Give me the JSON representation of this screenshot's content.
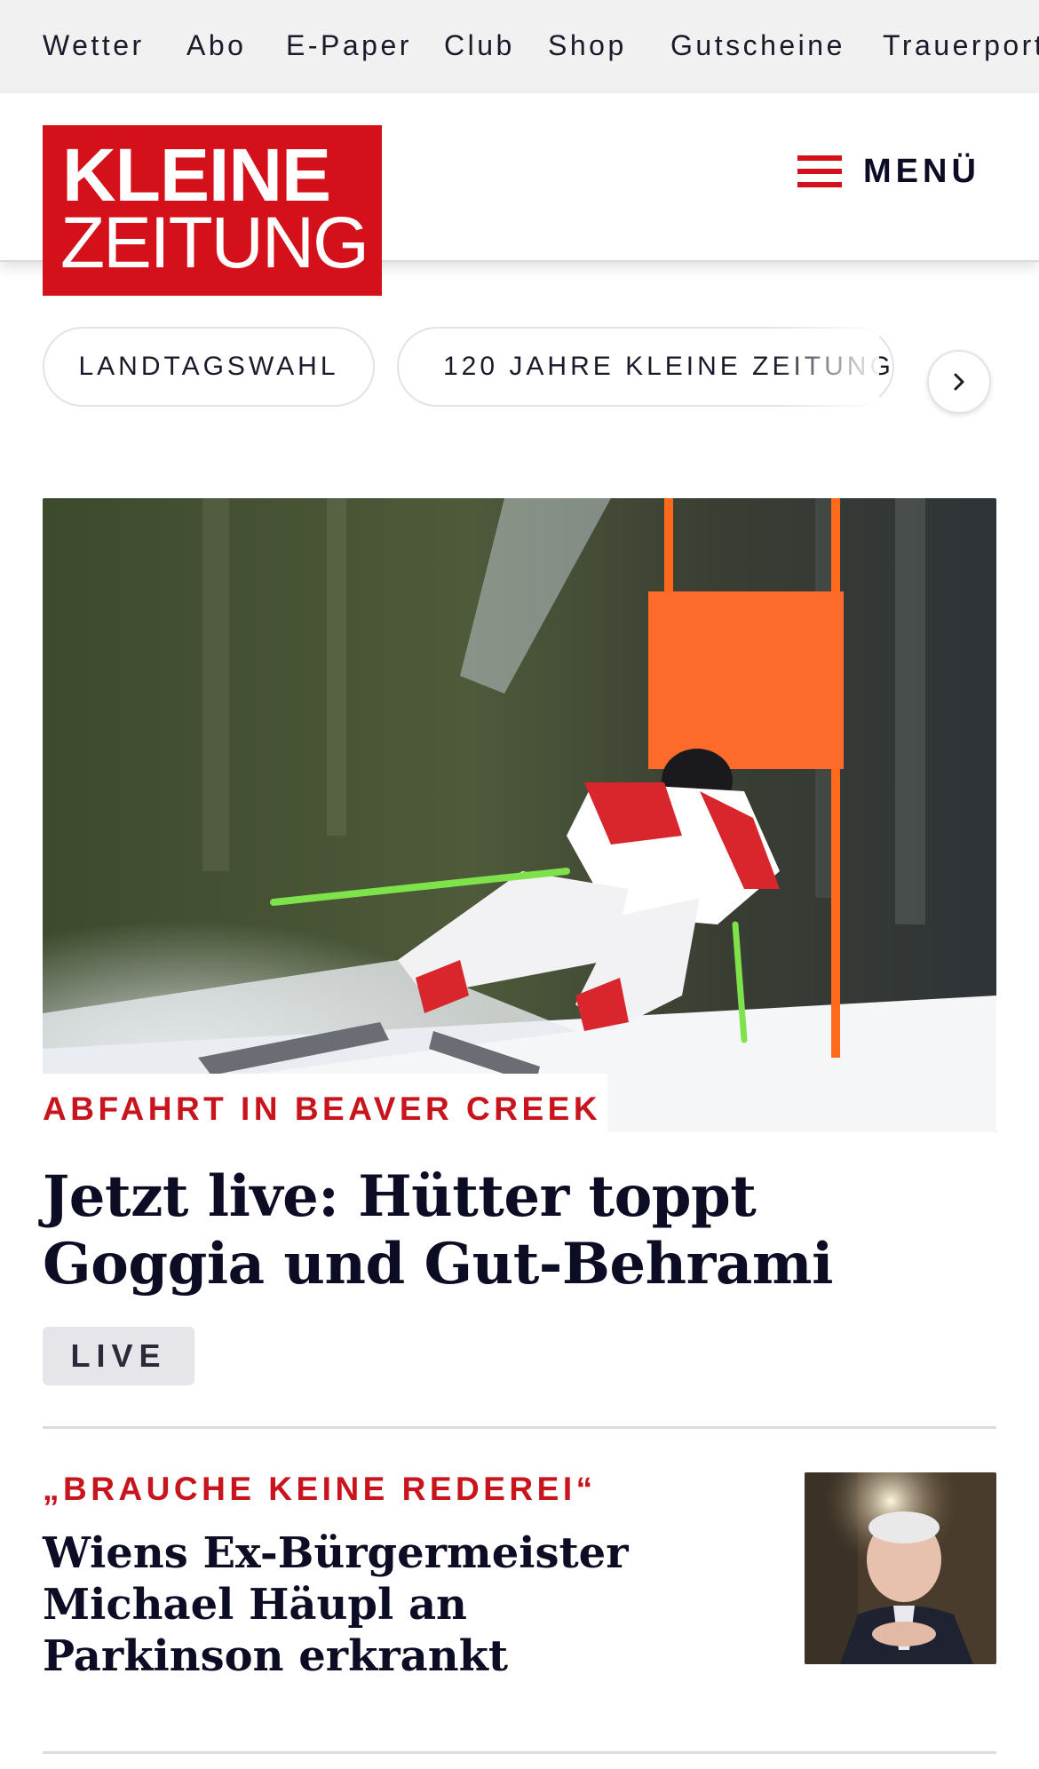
{
  "service_nav": {
    "items": [
      "Wetter",
      "Abo",
      "E-Paper",
      "Club",
      "Shop",
      "Gutscheine",
      "Trauerportal"
    ]
  },
  "header": {
    "logo_line1": "KLEINE",
    "logo_line2": "ZEITUNG",
    "menu_label": "MENÜ"
  },
  "topics": {
    "items": [
      "LANDTAGSWAHL",
      "120 JAHRE KLEINE ZEITUNG"
    ],
    "next_icon": "chevron-right-icon"
  },
  "hero": {
    "kicker": "ABFAHRT IN BEAVER CREEK",
    "title": "Jetzt live: Hütter toppt Goggia und Gut-Behrami",
    "badge": "LIVE"
  },
  "article2": {
    "kicker": "„BRAUCHE KEINE REDEREI“",
    "title": "Wiens Ex-Bürgermeister Michael Häupl an Parkinson erkrankt"
  },
  "colors": {
    "brand_red": "#d4111a",
    "kicker_red": "#c8141c",
    "headline": "#0c0c24",
    "nav_bg": "#f1f1f2"
  }
}
